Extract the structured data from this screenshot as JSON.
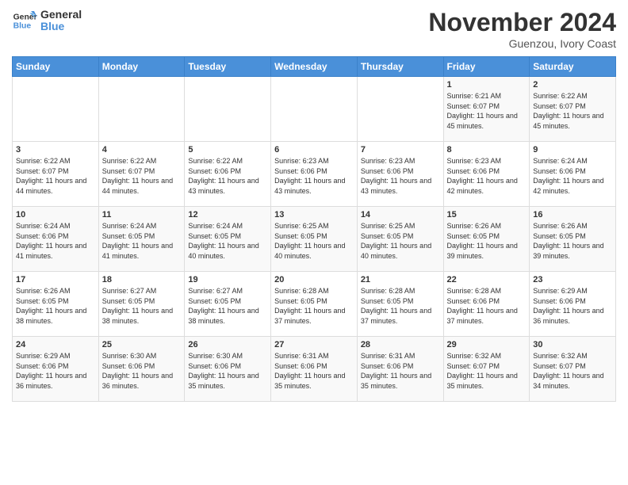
{
  "logo": {
    "line1": "General",
    "line2": "Blue"
  },
  "title": "November 2024",
  "location": "Guenzou, Ivory Coast",
  "days_header": [
    "Sunday",
    "Monday",
    "Tuesday",
    "Wednesday",
    "Thursday",
    "Friday",
    "Saturday"
  ],
  "weeks": [
    [
      {
        "day": "",
        "content": ""
      },
      {
        "day": "",
        "content": ""
      },
      {
        "day": "",
        "content": ""
      },
      {
        "day": "",
        "content": ""
      },
      {
        "day": "",
        "content": ""
      },
      {
        "day": "1",
        "content": "Sunrise: 6:21 AM\nSunset: 6:07 PM\nDaylight: 11 hours and 45 minutes."
      },
      {
        "day": "2",
        "content": "Sunrise: 6:22 AM\nSunset: 6:07 PM\nDaylight: 11 hours and 45 minutes."
      }
    ],
    [
      {
        "day": "3",
        "content": "Sunrise: 6:22 AM\nSunset: 6:07 PM\nDaylight: 11 hours and 44 minutes."
      },
      {
        "day": "4",
        "content": "Sunrise: 6:22 AM\nSunset: 6:07 PM\nDaylight: 11 hours and 44 minutes."
      },
      {
        "day": "5",
        "content": "Sunrise: 6:22 AM\nSunset: 6:06 PM\nDaylight: 11 hours and 43 minutes."
      },
      {
        "day": "6",
        "content": "Sunrise: 6:23 AM\nSunset: 6:06 PM\nDaylight: 11 hours and 43 minutes."
      },
      {
        "day": "7",
        "content": "Sunrise: 6:23 AM\nSunset: 6:06 PM\nDaylight: 11 hours and 43 minutes."
      },
      {
        "day": "8",
        "content": "Sunrise: 6:23 AM\nSunset: 6:06 PM\nDaylight: 11 hours and 42 minutes."
      },
      {
        "day": "9",
        "content": "Sunrise: 6:24 AM\nSunset: 6:06 PM\nDaylight: 11 hours and 42 minutes."
      }
    ],
    [
      {
        "day": "10",
        "content": "Sunrise: 6:24 AM\nSunset: 6:06 PM\nDaylight: 11 hours and 41 minutes."
      },
      {
        "day": "11",
        "content": "Sunrise: 6:24 AM\nSunset: 6:05 PM\nDaylight: 11 hours and 41 minutes."
      },
      {
        "day": "12",
        "content": "Sunrise: 6:24 AM\nSunset: 6:05 PM\nDaylight: 11 hours and 40 minutes."
      },
      {
        "day": "13",
        "content": "Sunrise: 6:25 AM\nSunset: 6:05 PM\nDaylight: 11 hours and 40 minutes."
      },
      {
        "day": "14",
        "content": "Sunrise: 6:25 AM\nSunset: 6:05 PM\nDaylight: 11 hours and 40 minutes."
      },
      {
        "day": "15",
        "content": "Sunrise: 6:26 AM\nSunset: 6:05 PM\nDaylight: 11 hours and 39 minutes."
      },
      {
        "day": "16",
        "content": "Sunrise: 6:26 AM\nSunset: 6:05 PM\nDaylight: 11 hours and 39 minutes."
      }
    ],
    [
      {
        "day": "17",
        "content": "Sunrise: 6:26 AM\nSunset: 6:05 PM\nDaylight: 11 hours and 38 minutes."
      },
      {
        "day": "18",
        "content": "Sunrise: 6:27 AM\nSunset: 6:05 PM\nDaylight: 11 hours and 38 minutes."
      },
      {
        "day": "19",
        "content": "Sunrise: 6:27 AM\nSunset: 6:05 PM\nDaylight: 11 hours and 38 minutes."
      },
      {
        "day": "20",
        "content": "Sunrise: 6:28 AM\nSunset: 6:05 PM\nDaylight: 11 hours and 37 minutes."
      },
      {
        "day": "21",
        "content": "Sunrise: 6:28 AM\nSunset: 6:05 PM\nDaylight: 11 hours and 37 minutes."
      },
      {
        "day": "22",
        "content": "Sunrise: 6:28 AM\nSunset: 6:06 PM\nDaylight: 11 hours and 37 minutes."
      },
      {
        "day": "23",
        "content": "Sunrise: 6:29 AM\nSunset: 6:06 PM\nDaylight: 11 hours and 36 minutes."
      }
    ],
    [
      {
        "day": "24",
        "content": "Sunrise: 6:29 AM\nSunset: 6:06 PM\nDaylight: 11 hours and 36 minutes."
      },
      {
        "day": "25",
        "content": "Sunrise: 6:30 AM\nSunset: 6:06 PM\nDaylight: 11 hours and 36 minutes."
      },
      {
        "day": "26",
        "content": "Sunrise: 6:30 AM\nSunset: 6:06 PM\nDaylight: 11 hours and 35 minutes."
      },
      {
        "day": "27",
        "content": "Sunrise: 6:31 AM\nSunset: 6:06 PM\nDaylight: 11 hours and 35 minutes."
      },
      {
        "day": "28",
        "content": "Sunrise: 6:31 AM\nSunset: 6:06 PM\nDaylight: 11 hours and 35 minutes."
      },
      {
        "day": "29",
        "content": "Sunrise: 6:32 AM\nSunset: 6:07 PM\nDaylight: 11 hours and 35 minutes."
      },
      {
        "day": "30",
        "content": "Sunrise: 6:32 AM\nSunset: 6:07 PM\nDaylight: 11 hours and 34 minutes."
      }
    ]
  ]
}
